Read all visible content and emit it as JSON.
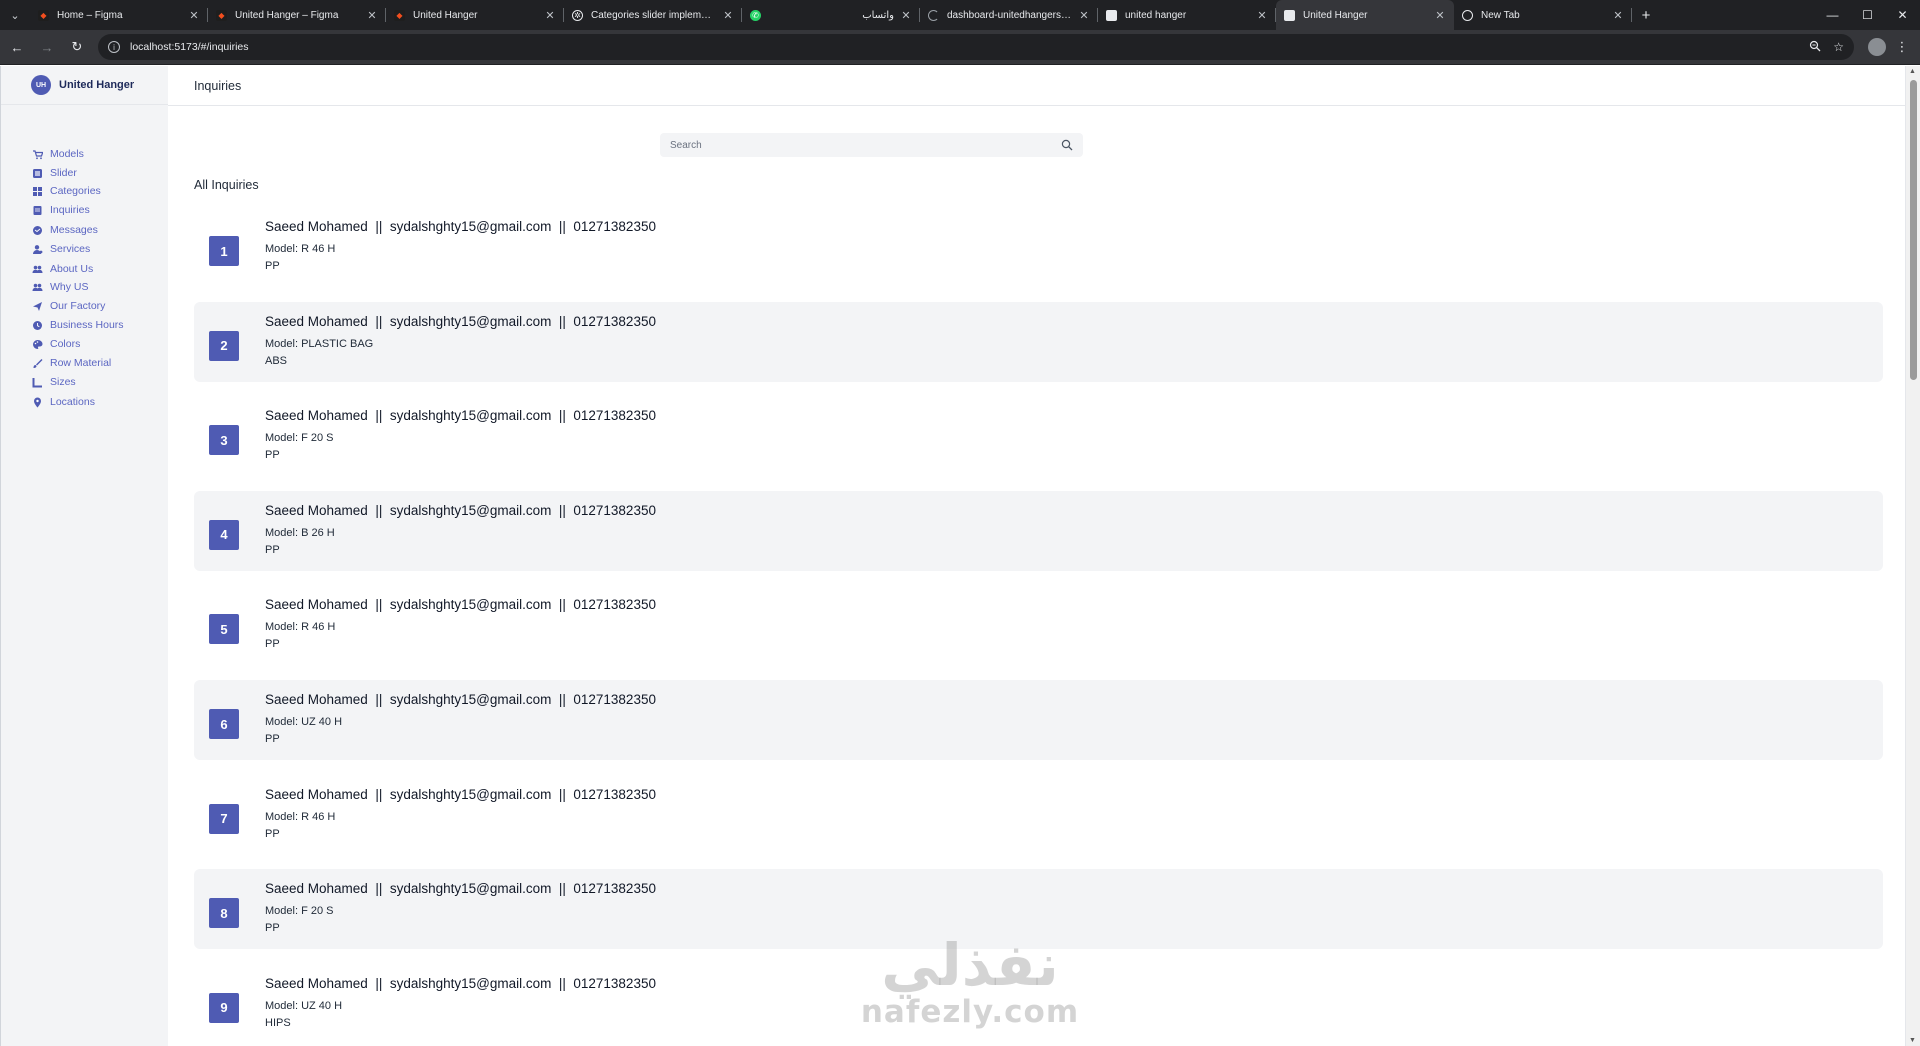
{
  "browser": {
    "tabs": [
      {
        "title": "Home – Figma",
        "icon": "figma-icon",
        "active": false
      },
      {
        "title": "United Hanger – Figma",
        "icon": "figma-icon",
        "active": false
      },
      {
        "title": "United Hanger",
        "icon": "figma-icon",
        "active": false
      },
      {
        "title": "Categories slider implementati",
        "icon": "chatgpt-icon",
        "active": false
      },
      {
        "title": "واتساب",
        "icon": "whatsapp-icon",
        "active": false
      },
      {
        "title": "dashboard-unitedhangers-proc",
        "icon": "loading-icon",
        "active": false
      },
      {
        "title": "united hanger",
        "icon": "page-icon",
        "active": false
      },
      {
        "title": "United Hanger",
        "icon": "page-icon",
        "active": true
      },
      {
        "title": "New Tab",
        "icon": "globe-icon",
        "active": false
      }
    ],
    "url": "localhost:5173/#/inquiries"
  },
  "app": {
    "brand_initials": "UH",
    "brand_name": "United Hanger",
    "page_title": "Inquiries",
    "sidebar": [
      {
        "label": "Models",
        "icon": "cart-icon"
      },
      {
        "label": "Slider",
        "icon": "slider-icon"
      },
      {
        "label": "Categories",
        "icon": "grid-icon"
      },
      {
        "label": "Inquiries",
        "icon": "document-icon"
      },
      {
        "label": "Messages",
        "icon": "message-icon"
      },
      {
        "label": "Services",
        "icon": "user-gear-icon"
      },
      {
        "label": "About Us",
        "icon": "users-icon"
      },
      {
        "label": "Why US",
        "icon": "users-icon"
      },
      {
        "label": "Our Factory",
        "icon": "send-icon"
      },
      {
        "label": "Business Hours",
        "icon": "clock-icon"
      },
      {
        "label": "Colors",
        "icon": "palette-icon"
      },
      {
        "label": "Row Material",
        "icon": "brush-icon"
      },
      {
        "label": "Sizes",
        "icon": "ruler-icon"
      },
      {
        "label": "Locations",
        "icon": "pin-icon"
      }
    ],
    "search_placeholder": "Search",
    "section_title": "All Inquiries",
    "inquiries": [
      {
        "num": "1",
        "contact": "Saeed Mohamed  ||  sydalshghty15@gmail.com  ||  01271382350",
        "model": "Model: R 46 H",
        "material": "PP"
      },
      {
        "num": "2",
        "contact": "Saeed Mohamed  ||  sydalshghty15@gmail.com  ||  01271382350",
        "model": "Model: PLASTIC BAG",
        "material": "ABS"
      },
      {
        "num": "3",
        "contact": "Saeed Mohamed  ||  sydalshghty15@gmail.com  ||  01271382350",
        "model": "Model: F 20 S",
        "material": "PP"
      },
      {
        "num": "4",
        "contact": "Saeed Mohamed  ||  sydalshghty15@gmail.com  ||  01271382350",
        "model": "Model: B 26 H",
        "material": "PP"
      },
      {
        "num": "5",
        "contact": "Saeed Mohamed  ||  sydalshghty15@gmail.com  ||  01271382350",
        "model": "Model: R 46 H",
        "material": "PP"
      },
      {
        "num": "6",
        "contact": "Saeed Mohamed  ||  sydalshghty15@gmail.com  ||  01271382350",
        "model": "Model: UZ 40 H",
        "material": "PP"
      },
      {
        "num": "7",
        "contact": "Saeed Mohamed  ||  sydalshghty15@gmail.com  ||  01271382350",
        "model": "Model: R 46 H",
        "material": "PP"
      },
      {
        "num": "8",
        "contact": "Saeed Mohamed  ||  sydalshghty15@gmail.com  ||  01271382350",
        "model": "Model: F 20 S",
        "material": "PP"
      },
      {
        "num": "9",
        "contact": "Saeed Mohamed  ||  sydalshghty15@gmail.com  ||  01271382350",
        "model": "Model: UZ 40 H",
        "material": "HIPS"
      }
    ],
    "accent_color": "#4f5bb3"
  },
  "watermark": {
    "arabic": "نفذلي",
    "latin": "nafezly.com"
  }
}
